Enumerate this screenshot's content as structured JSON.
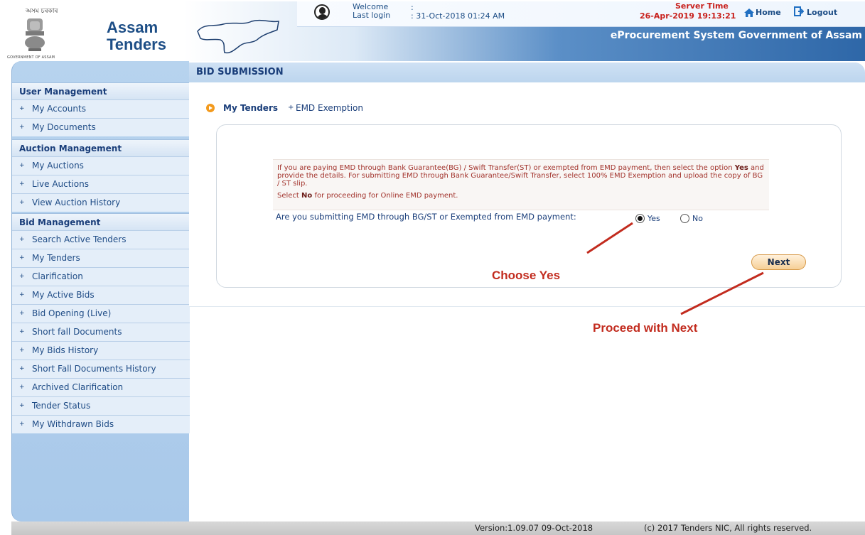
{
  "header": {
    "gov_bengali": "অসম চৰকাৰ",
    "gov_caption": "GOVERNMENT OF ASSAM",
    "brand_line1": "Assam",
    "brand_line2": "Tenders",
    "welcome_label": "Welcome",
    "welcome_colon": ":",
    "last_login_label": "Last login",
    "last_login_value": ": 31-Oct-2018 01:24 AM",
    "server_time_label": "Server Time",
    "server_time_value": "26-Apr-2019 19:13:21",
    "home_label": "Home",
    "logout_label": "Logout",
    "tagline": "eProcurement System Government of Assam"
  },
  "sidebar": {
    "sections": [
      {
        "title": "User Management",
        "items": [
          "My Accounts",
          "My Documents"
        ]
      },
      {
        "title": "Auction Management",
        "items": [
          "My Auctions",
          "Live Auctions",
          "View Auction History"
        ]
      },
      {
        "title": "Bid Management",
        "items": [
          "Search Active Tenders",
          "My Tenders",
          "Clarification",
          "My Active Bids",
          "Bid Opening (Live)",
          "Short fall Documents",
          "My Bids History",
          "Short Fall Documents History",
          "Archived Clarification",
          "Tender Status",
          "My Withdrawn Bids"
        ]
      }
    ]
  },
  "main": {
    "title": "BID SUBMISSION",
    "breadcrumb": {
      "parent": "My Tenders",
      "sep": "+",
      "current": "EMD Exemption"
    },
    "info": {
      "p1_a": "If you are paying EMD through Bank Guarantee(BG) / Swift Transfer(ST) or exempted from EMD payment, then select the option ",
      "p1_b": "Yes",
      "p1_c": " and provide the details. For submitting EMD through Bank Guarantee/Swift Transfer, select 100% EMD Exemption and upload the copy of BG / ST slip.",
      "p2_a": "Select ",
      "p2_b": "No",
      "p2_c": " for proceeding for Online EMD payment."
    },
    "question": "Are you submitting EMD through BG/ST or Exempted from EMD payment:",
    "options": {
      "yes": "Yes",
      "no": "No",
      "selected": "Yes"
    },
    "next_label": "Next"
  },
  "annotations": {
    "choose": "Choose Yes",
    "proceed": "Proceed with Next",
    "color": "#c22b1e"
  },
  "footer": {
    "version": "Version:1.09.07 09-Oct-2018",
    "copyright": "(c) 2017 Tenders NIC, All rights reserved."
  }
}
